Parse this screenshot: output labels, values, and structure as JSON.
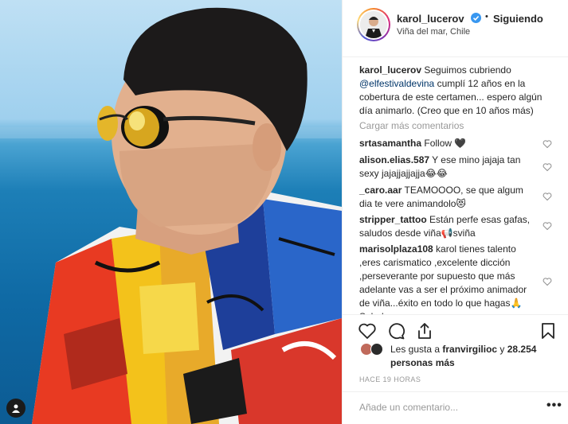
{
  "post": {
    "username": "karol_lucerov",
    "follow_status": "Siguiendo",
    "separator": "•",
    "location": "Viña del mar, Chile"
  },
  "caption": {
    "username": "karol_lucerov",
    "text_before": " Seguimos cubriendo ",
    "mention": "@elfestivaldevina",
    "text_after": " cumplí 12 años en la cobertura de este certamen... espero algún día animarlo. (Creo que en 10 años más)"
  },
  "load_more": "Cargar más comentarios",
  "comments": [
    {
      "user": "srtasamantha",
      "text": " Follow 🖤"
    },
    {
      "user": "alison.elias.587",
      "text": " Y ese mino jajaja tan sexy jajajjajjajja😂😂"
    },
    {
      "user": "_caro.aar",
      "text": " TEAMOOOO, se que algum dia te vere animandolo😻"
    },
    {
      "user": "stripper_tattoo",
      "text": " Están perfe esas gafas, saludos desde viña📢sviña"
    },
    {
      "user": "marisolplaza108",
      "text": " karol tienes talento ,eres carismatico ,excelente dicción ,perseverante por supuesto que más adelante vas a ser el próximo animador de viña...éxito en todo lo que hagas🙏 Saludos"
    }
  ],
  "likes": {
    "prefix": "Les gusta a ",
    "user": "franvirgilioc",
    "middle": " y ",
    "count": "28.254 personas más"
  },
  "timestamp": "HACE 19 HORAS",
  "add_comment": {
    "placeholder": "Añade un comentario..."
  },
  "more_label": "•••",
  "icons": {
    "verified": "verified-badge-icon",
    "like": "heart-icon",
    "comment": "comment-icon",
    "share": "share-icon",
    "save": "bookmark-icon",
    "user_tag": "user-tag-icon"
  },
  "colors": {
    "verified": "#3897f0",
    "text": "#262626",
    "muted": "#999999",
    "mention": "#003569"
  }
}
